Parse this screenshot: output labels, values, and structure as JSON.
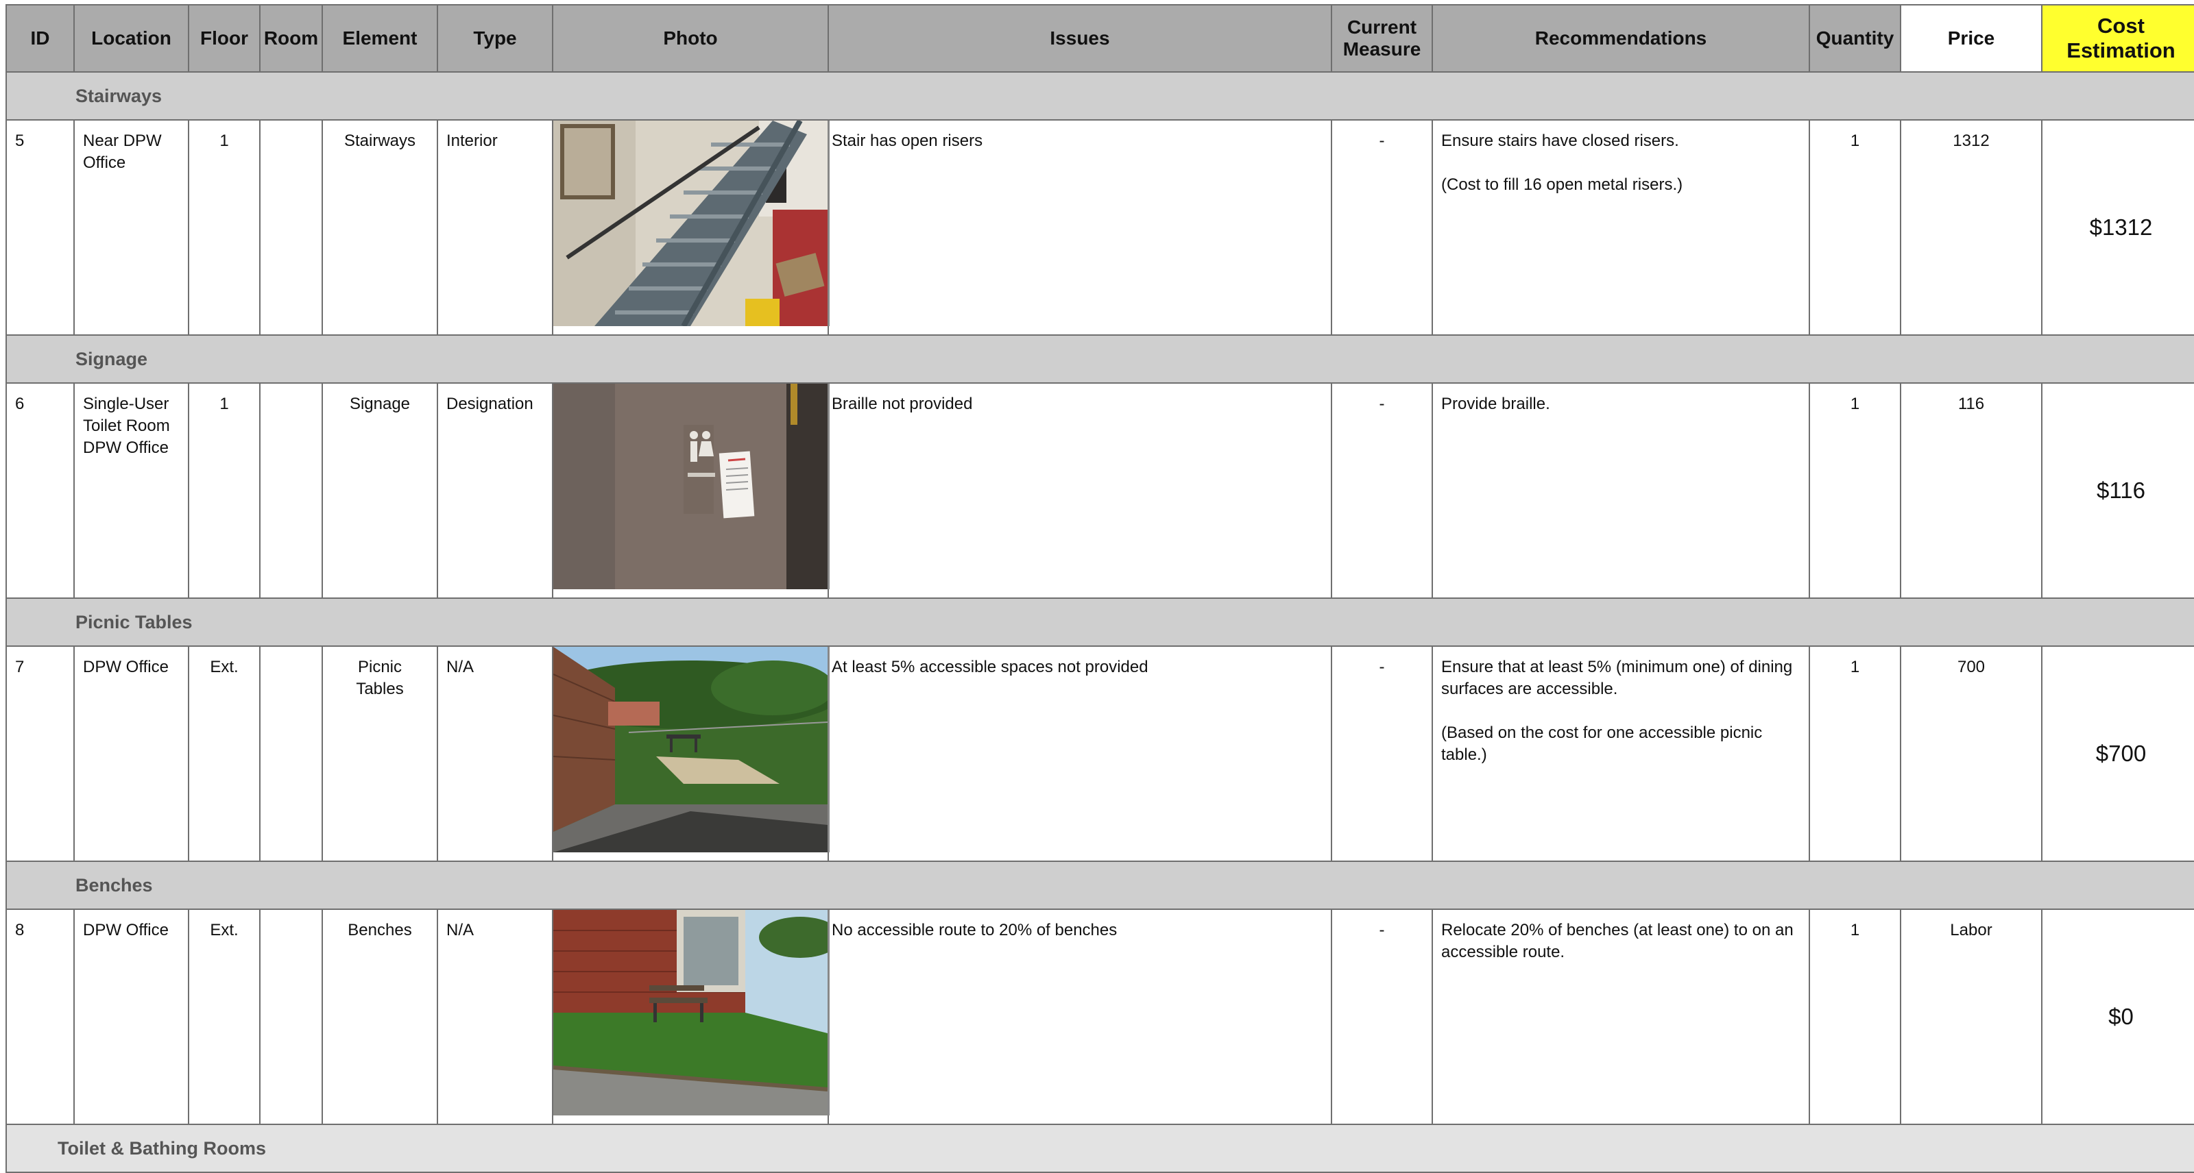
{
  "columns": {
    "id": "ID",
    "location": "Location",
    "floor": "Floor",
    "room": "Room",
    "element": "Element",
    "type": "Type",
    "photo": "Photo",
    "issues": "Issues",
    "current_measure_line1": "Current",
    "current_measure_line2": "Measure",
    "recommendations": "Recommendations",
    "quantity": "Quantity",
    "price": "Price",
    "cost_line1": "Cost",
    "cost_line2": "Estimation"
  },
  "colors": {
    "header_bg": "#ababab",
    "section_bg": "#cfcfcf",
    "cost_header_bg": "#ffff2e"
  },
  "sections": [
    {
      "title": "Stairways",
      "row": {
        "id": "5",
        "location_lines": [
          "Near DPW",
          "Office"
        ],
        "floor": "1",
        "room": "",
        "element_lines": [
          "Stairways"
        ],
        "type": "Interior",
        "photo_icon": "stairway-photo",
        "issue": "Stair has open risers",
        "current_measure": "-",
        "recommendations": [
          "Ensure stairs have closed risers.",
          "(Cost to fill 16 open metal risers.)"
        ],
        "quantity": "1",
        "price": "1312",
        "cost": "$1312"
      }
    },
    {
      "title": "Signage",
      "row": {
        "id": "6",
        "location_lines": [
          "Single-User",
          "Toilet Room",
          "DPW Office"
        ],
        "floor": "1",
        "room": "",
        "element_lines": [
          "Signage"
        ],
        "type": "Designation",
        "photo_icon": "restroom-sign-photo",
        "issue": "Braille not provided",
        "current_measure": "-",
        "recommendations": [
          "Provide braille."
        ],
        "quantity": "1",
        "price": "116",
        "cost": "$116"
      }
    },
    {
      "title": "Picnic Tables",
      "row": {
        "id": "7",
        "location_lines": [
          "DPW Office"
        ],
        "floor": "Ext.",
        "room": "",
        "element_lines": [
          "Picnic",
          "Tables"
        ],
        "type": "N/A",
        "photo_icon": "picnic-area-photo",
        "issue": "At least 5% accessible spaces not provided",
        "current_measure": "-",
        "recommendations": [
          "Ensure that at least 5% (minimum one) of dining surfaces are accessible.",
          "(Based on the cost for one accessible picnic table.)"
        ],
        "quantity": "1",
        "price": "700",
        "cost": "$700"
      }
    },
    {
      "title": "Benches",
      "row": {
        "id": "8",
        "location_lines": [
          "DPW Office"
        ],
        "floor": "Ext.",
        "room": "",
        "element_lines": [
          "Benches"
        ],
        "type": "N/A",
        "photo_icon": "bench-photo",
        "issue": "No accessible route to 20% of benches",
        "current_measure": "-",
        "recommendations": [
          "Relocate 20% of benches (at least one) to on an accessible route."
        ],
        "quantity": "1",
        "price": "Labor",
        "cost": "$0"
      }
    }
  ],
  "next_section": "Toilet & Bathing Rooms"
}
